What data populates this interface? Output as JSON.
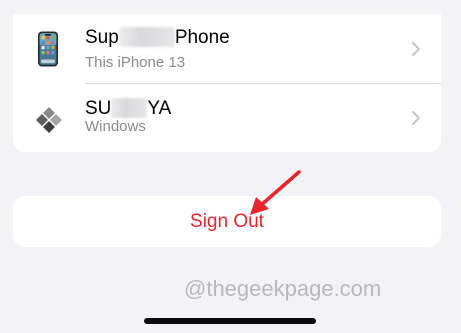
{
  "devices": [
    {
      "name_start": "Sup",
      "name_end": "Phone",
      "subtitle": "This iPhone 13",
      "icon": "iphone-icon"
    },
    {
      "name_start": "SU",
      "name_end": "YA",
      "subtitle": "Windows",
      "icon": "windows-icon"
    }
  ],
  "sign_out": {
    "label": "Sign Out",
    "color": "#e8262b"
  },
  "annotation": {
    "arrow_color": "#e8262b",
    "icon": "red-arrow-icon"
  },
  "watermark": {
    "text": "@thegeekpage.com"
  },
  "colors": {
    "background": "#f2f2f7",
    "card": "#ffffff",
    "secondary_text": "#8a8a8e"
  }
}
